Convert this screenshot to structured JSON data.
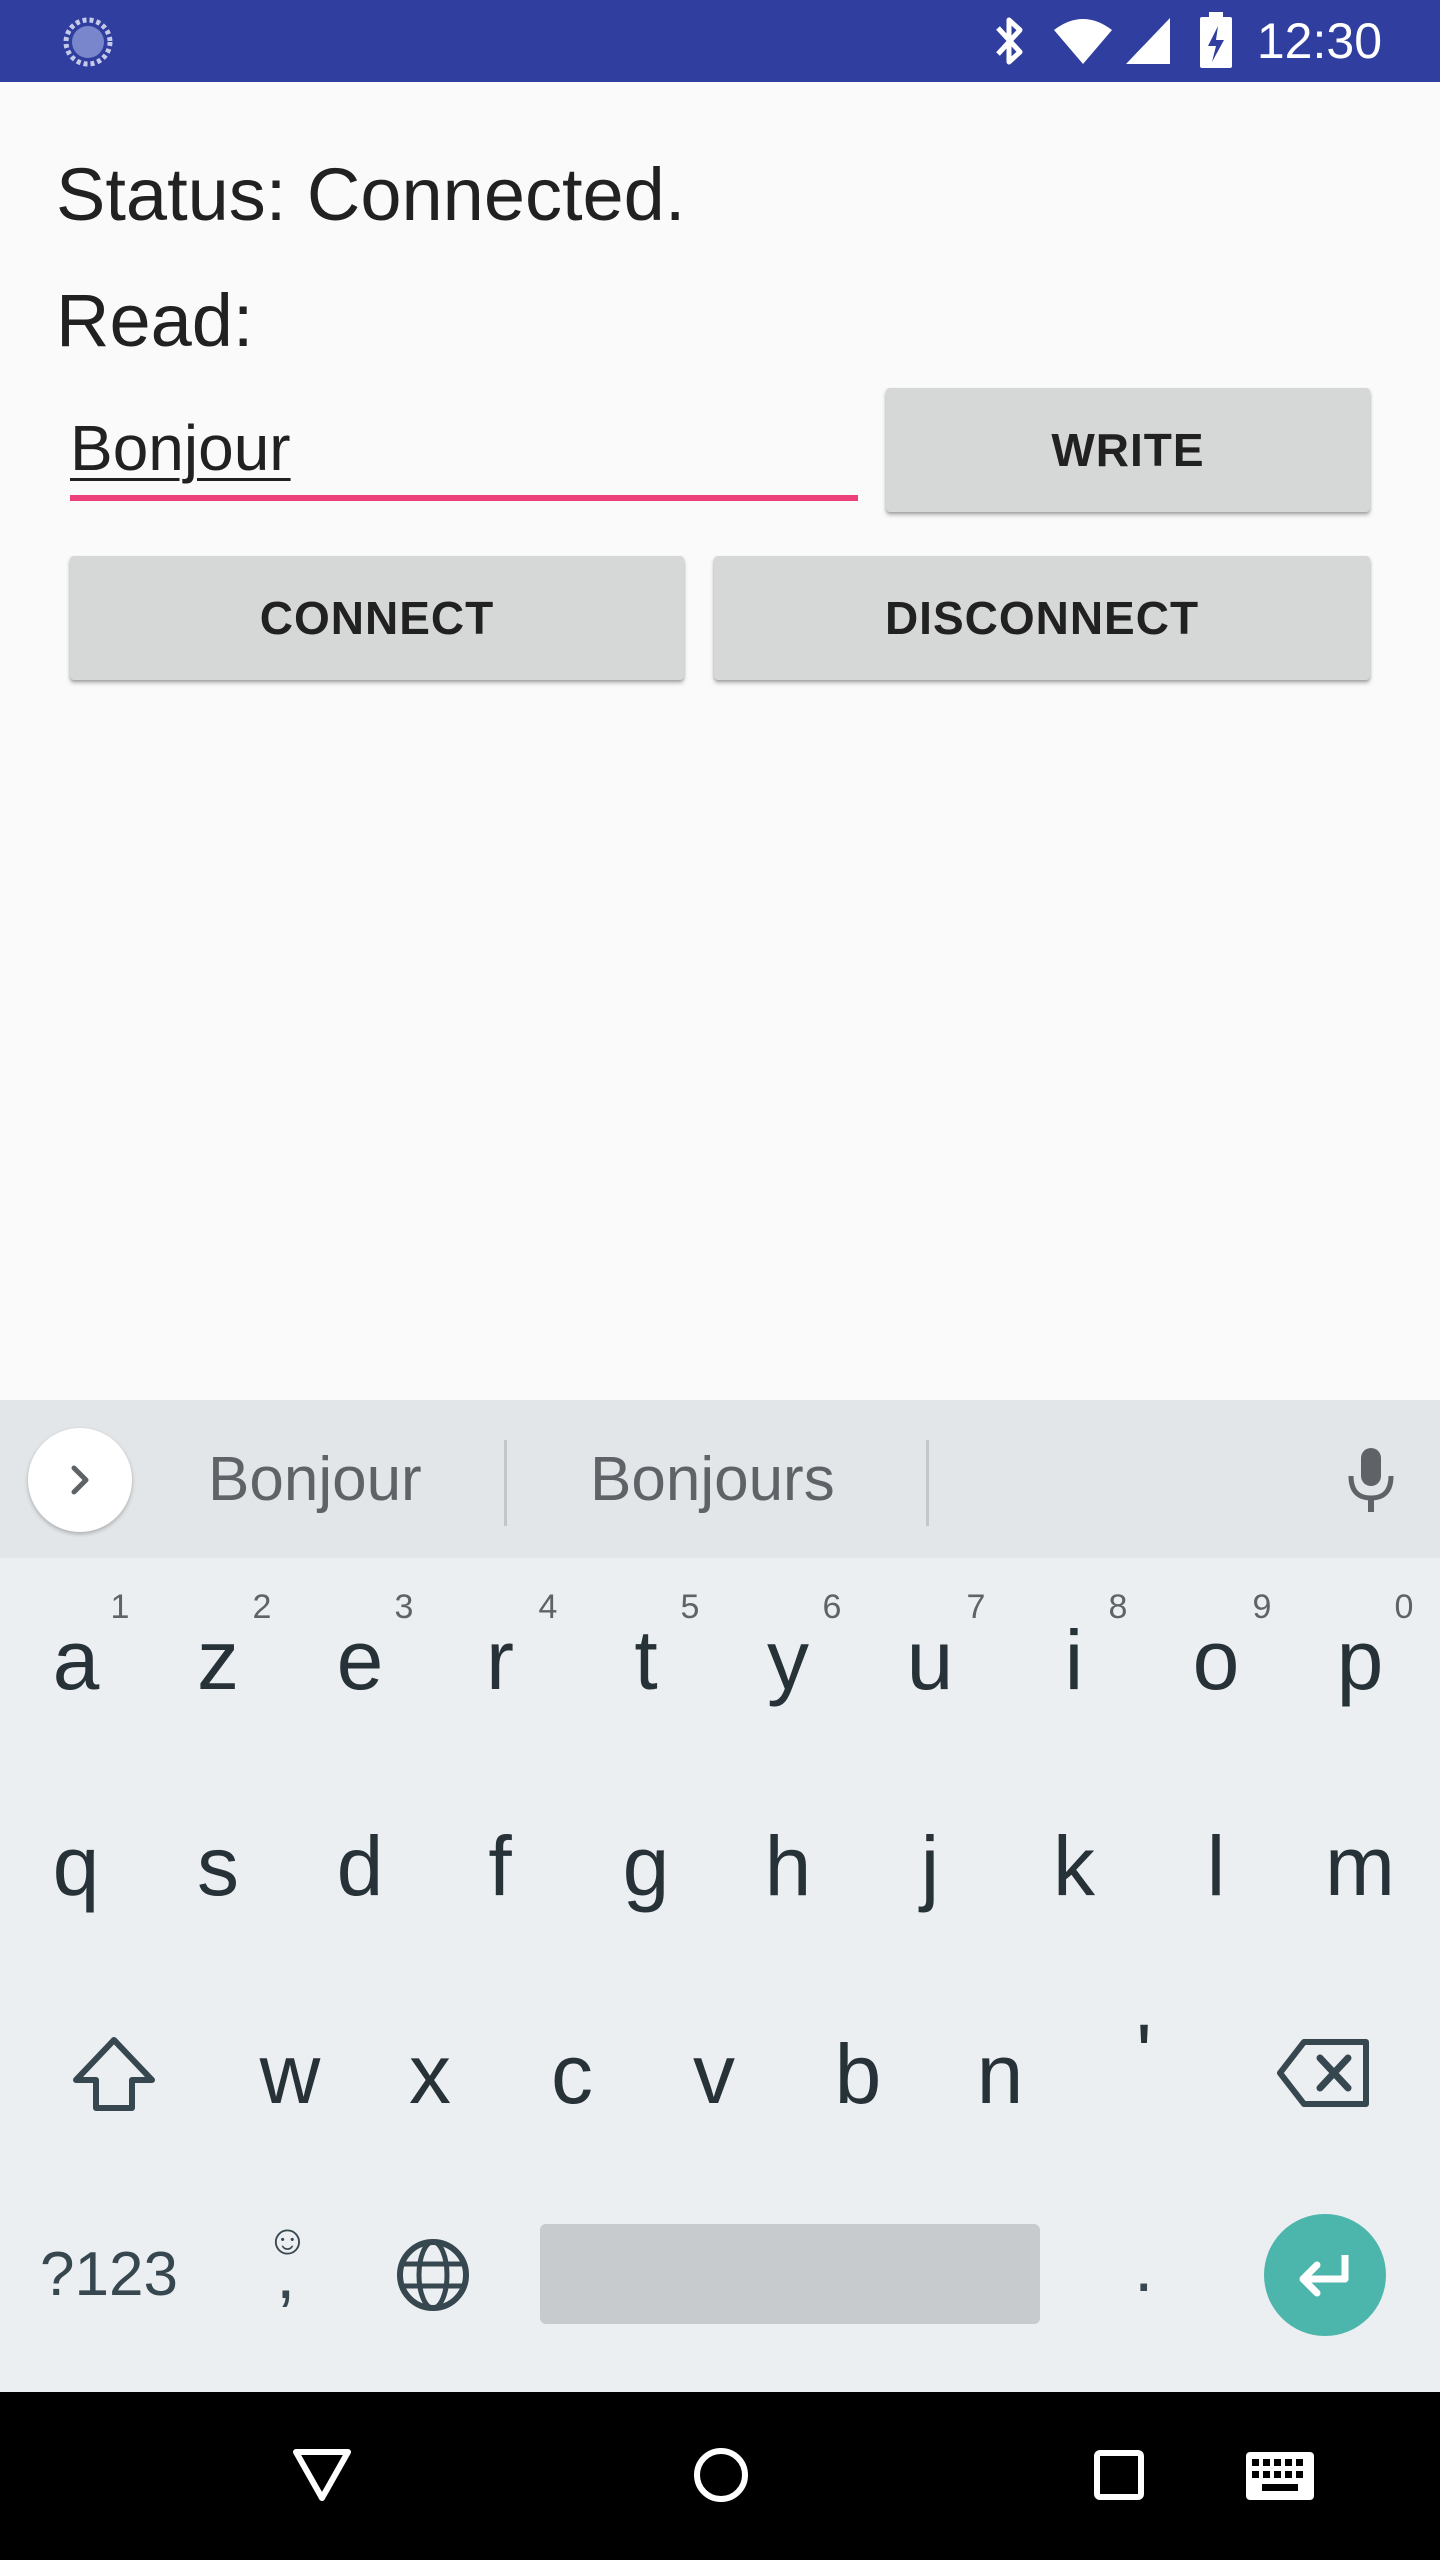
{
  "status_bar": {
    "time": "12:30",
    "icons": [
      "sync-icon",
      "bluetooth-icon",
      "wifi-icon",
      "signal-icon",
      "battery-charging-icon"
    ]
  },
  "app": {
    "status_text": "Status: Connected.",
    "read_label": "Read:",
    "input_value": "Bonjour",
    "write_button": "WRITE",
    "connect_button": "CONNECT",
    "disconnect_button": "DISCONNECT"
  },
  "keyboard": {
    "suggestions": [
      "Bonjour",
      "Bonjours"
    ],
    "row1": [
      {
        "key": "a",
        "hint": "1"
      },
      {
        "key": "z",
        "hint": "2"
      },
      {
        "key": "e",
        "hint": "3"
      },
      {
        "key": "r",
        "hint": "4"
      },
      {
        "key": "t",
        "hint": "5"
      },
      {
        "key": "y",
        "hint": "6"
      },
      {
        "key": "u",
        "hint": "7"
      },
      {
        "key": "i",
        "hint": "8"
      },
      {
        "key": "o",
        "hint": "9"
      },
      {
        "key": "p",
        "hint": "0"
      }
    ],
    "row2": [
      "q",
      "s",
      "d",
      "f",
      "g",
      "h",
      "j",
      "k",
      "l",
      "m"
    ],
    "row3": [
      "w",
      "x",
      "c",
      "v",
      "b",
      "n",
      "'"
    ],
    "symbols_key": "?123",
    "comma_key": ",",
    "emoji_hint": "☺",
    "period_key": "."
  },
  "colors": {
    "status_bar": "#303f9f",
    "input_underline": "#ec407a",
    "enter_key": "#4db6ac"
  }
}
